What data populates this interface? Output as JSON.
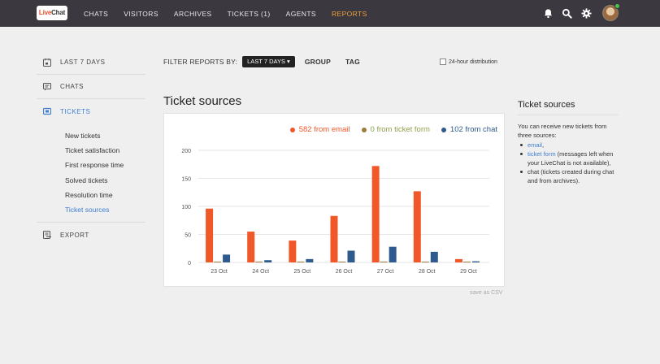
{
  "brand": {
    "logo_live": "Live",
    "logo_chat": "Chat"
  },
  "nav": [
    {
      "id": "chats",
      "label": "CHATS"
    },
    {
      "id": "visitors",
      "label": "VISITORS"
    },
    {
      "id": "archives",
      "label": "ARCHIVES"
    },
    {
      "id": "tickets",
      "label": "TICKETS (1)"
    },
    {
      "id": "agents",
      "label": "AGENTS"
    },
    {
      "id": "reports",
      "label": "REPORTS",
      "active": true
    }
  ],
  "top_icons": [
    "bell-icon",
    "search-icon",
    "gear-icon"
  ],
  "sidebar": {
    "last7": "LAST 7 DAYS",
    "chats": "CHATS",
    "tickets": "TICKETS",
    "export": "EXPORT",
    "ticket_subitems": [
      {
        "label": "New tickets"
      },
      {
        "label": "Ticket satisfaction"
      },
      {
        "label": "First response time"
      },
      {
        "label": "Solved tickets"
      },
      {
        "label": "Resolution time"
      },
      {
        "label": "Ticket sources",
        "active": true
      }
    ]
  },
  "filter": {
    "label": "FILTER REPORTS BY:",
    "selected": "LAST 7 DAYS ▾",
    "group": "GROUP",
    "tag": "TAG",
    "distribution": "24-hour distribution"
  },
  "main": {
    "title": "Ticket sources",
    "csv": "save as CSV"
  },
  "colors": {
    "email": "#f0582a",
    "form": "#9c7b3c",
    "chat": "#2f5a8e",
    "accent": "#f3a13a",
    "link": "#3f7fd0"
  },
  "chart_data": {
    "type": "bar",
    "categories": [
      "23 Oct",
      "24 Oct",
      "25 Oct",
      "26 Oct",
      "27 Oct",
      "28 Oct",
      "29 Oct"
    ],
    "series": [
      {
        "name": "582 from email",
        "values": [
          96,
          55,
          39,
          83,
          172,
          127,
          6
        ]
      },
      {
        "name": "0 from ticket form",
        "values": [
          0,
          0,
          0,
          0,
          0,
          0,
          0
        ]
      },
      {
        "name": "102 from chat",
        "values": [
          14,
          4,
          6,
          21,
          28,
          19,
          2
        ]
      }
    ],
    "ylim": [
      0,
      200
    ],
    "yticks": [
      0,
      50,
      100,
      150,
      200
    ],
    "grid": true,
    "legend": "top-right"
  },
  "rpanel": {
    "title": "Ticket sources",
    "intro": "You can receive new tickets from three sources:",
    "items": [
      {
        "link": "email",
        "text": ","
      },
      {
        "link": "ticket form",
        "text": " (messages left when your LiveChat is not available),"
      },
      {
        "link": "",
        "text": "chat (tickets created during chat and from archives)."
      }
    ]
  }
}
